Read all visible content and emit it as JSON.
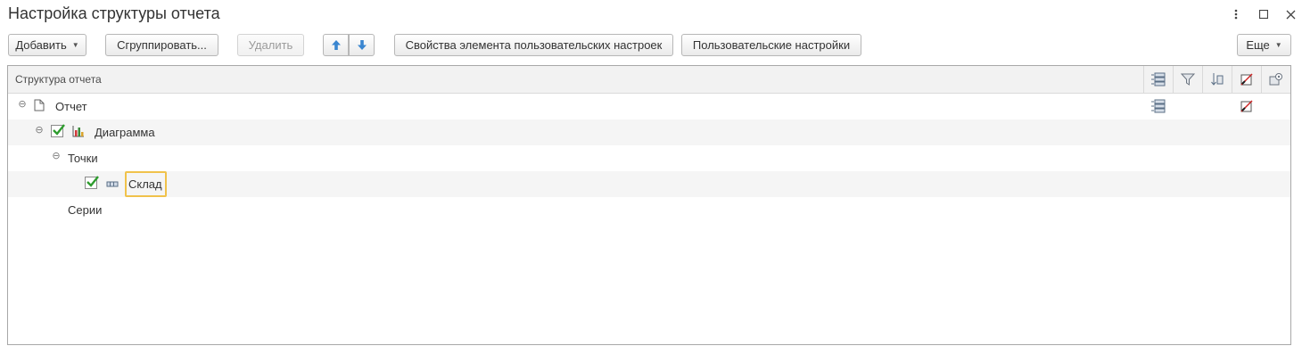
{
  "window": {
    "title": "Настройка структуры отчета",
    "controls": [
      "more-icon",
      "maximize-icon",
      "close-icon"
    ]
  },
  "toolbar": {
    "add_label": "Добавить",
    "group_label": "Сгруппировать...",
    "delete_label": "Удалить",
    "element_props_label": "Свойства элемента пользовательских настроек",
    "user_settings_label": "Пользовательские настройки",
    "more_label": "Еще",
    "up_icon": "arrow-up-icon",
    "down_icon": "arrow-down-icon"
  },
  "table": {
    "header": "Структура отчета",
    "header_icons": [
      "selected-fields-icon",
      "filter-icon",
      "order-icon",
      "conditional-format-icon",
      "settings-icon"
    ],
    "rows": [
      {
        "label": "Отчет",
        "expanded": true,
        "checked": null,
        "icon": "document-icon"
      },
      {
        "label": "Диаграмма",
        "expanded": true,
        "checked": true,
        "icon": "chart-icon"
      },
      {
        "label": "Точки",
        "expanded": true,
        "checked": null,
        "icon": null
      },
      {
        "label": "Склад",
        "expanded": null,
        "checked": true,
        "icon": "grouping-field-icon"
      },
      {
        "label": "Серии",
        "expanded": null,
        "checked": null,
        "icon": null
      }
    ]
  },
  "colors": {
    "accent_green": "#2e9c2e",
    "arrow_blue": "#3a86d0",
    "edit_border": "#f0c24b",
    "alt_row": "#f5f5f5"
  }
}
